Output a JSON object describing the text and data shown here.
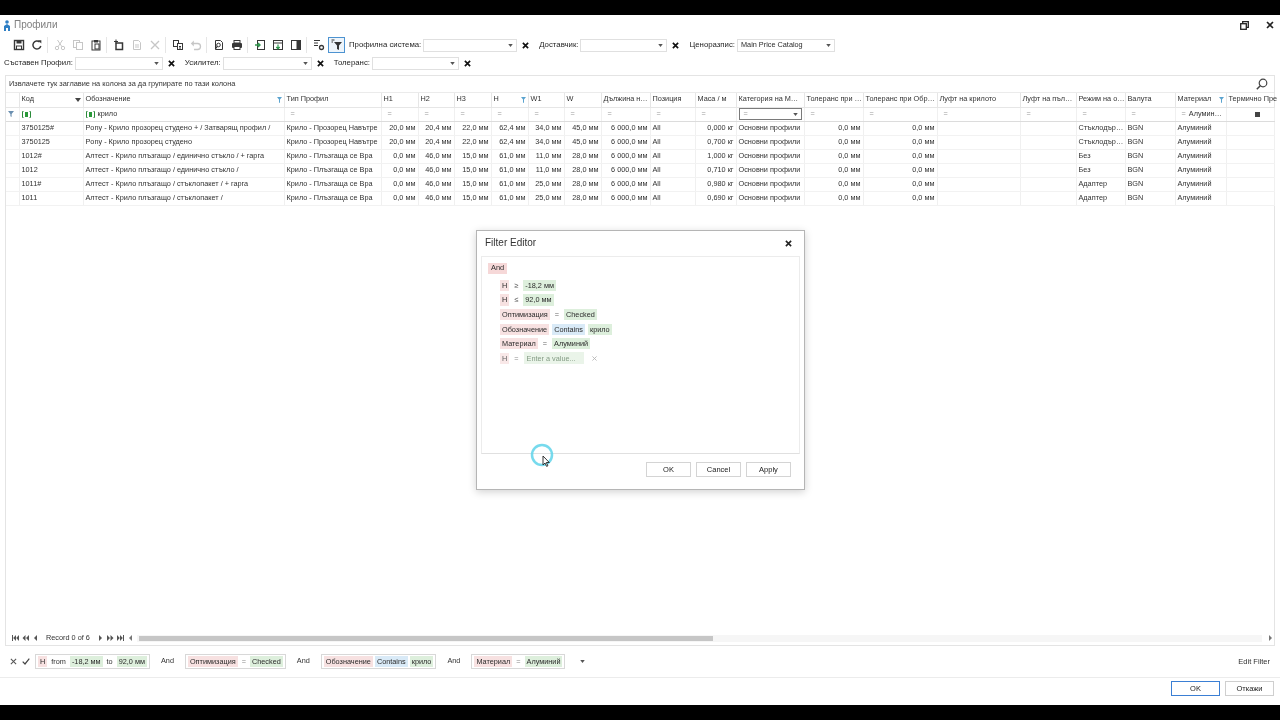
{
  "window": {
    "title": "Профили"
  },
  "toolbar": {
    "groups": [
      [
        {
          "disabled": false,
          "on": false
        },
        {
          "disabled": false,
          "on": false
        }
      ],
      [
        {
          "disabled": true,
          "on": false
        },
        {
          "disabled": true,
          "on": false
        },
        {
          "disabled": false,
          "on": false
        }
      ],
      [
        {
          "disabled": false,
          "on": false
        },
        {
          "disabled": true,
          "on": false
        },
        {
          "disabled": true,
          "on": false
        }
      ],
      [
        {
          "disabled": false,
          "on": false
        },
        {
          "disabled": true,
          "on": false
        }
      ],
      [
        {
          "disabled": false,
          "on": false
        },
        {
          "disabled": false,
          "on": false
        }
      ],
      [
        {
          "disabled": false,
          "on": false
        },
        {
          "disabled": false,
          "on": false
        },
        {
          "disabled": false,
          "on": false
        }
      ],
      [
        {
          "disabled": false,
          "on": false
        },
        {
          "disabled": false,
          "on": true
        }
      ]
    ],
    "selectors": [
      {
        "label": "Профилна система:",
        "clearable": true
      },
      {
        "label": "Доставчик:",
        "clearable": true
      },
      {
        "label": "Ценоразпис:",
        "value": "Main Price Catalog",
        "clearable": false
      }
    ]
  },
  "selector_row": [
    {
      "label": "Съставен Профил:",
      "clearable": true
    },
    {
      "label": "Усилител:",
      "clearable": true
    },
    {
      "label": "Толеранс:",
      "clearable": true
    }
  ],
  "grid": {
    "group_panel": "Извлачете тук заглавие на колона за да групирате по тази колона",
    "columns": [
      {
        "title": "Код",
        "kind": "text",
        "sorted": true,
        "filtered": false
      },
      {
        "title": "Обозначение",
        "kind": "text",
        "sorted": false,
        "filtered": true
      },
      {
        "title": "Тип Профил",
        "kind": "text",
        "sorted": false,
        "filtered": false
      },
      {
        "title": "H1",
        "kind": "number",
        "sorted": false,
        "filtered": false
      },
      {
        "title": "H2",
        "kind": "number",
        "sorted": false,
        "filtered": false
      },
      {
        "title": "H3",
        "kind": "number",
        "sorted": false,
        "filtered": false
      },
      {
        "title": "H",
        "kind": "number",
        "sorted": false,
        "filtered": true
      },
      {
        "title": "W1",
        "kind": "number",
        "sorted": false,
        "filtered": false
      },
      {
        "title": "W",
        "kind": "number",
        "sorted": false,
        "filtered": false
      },
      {
        "title": "Дължина н…",
        "kind": "number",
        "sorted": false,
        "filtered": false
      },
      {
        "title": "Позиция",
        "kind": "text",
        "sorted": false,
        "filtered": false
      },
      {
        "title": "Маса / м",
        "kind": "number",
        "sorted": false,
        "filtered": false
      },
      {
        "title": "Категория на М…",
        "kind": "text",
        "sorted": false,
        "filtered": false
      },
      {
        "title": "Толеранс при …",
        "kind": "number",
        "sorted": false,
        "filtered": false
      },
      {
        "title": "Толеранс при Обр…",
        "kind": "number",
        "sorted": false,
        "filtered": false
      },
      {
        "title": "Луфт на крилото",
        "kind": "number",
        "sorted": false,
        "filtered": false
      },
      {
        "title": "Луфт на пъл…",
        "kind": "number",
        "sorted": false,
        "filtered": false
      },
      {
        "title": "Режим на о…",
        "kind": "text",
        "sorted": false,
        "filtered": false
      },
      {
        "title": "Валута",
        "kind": "text",
        "sorted": false,
        "filtered": false
      },
      {
        "title": "Материал",
        "kind": "text",
        "sorted": false,
        "filtered": true
      },
      {
        "title": "Термично Пре",
        "kind": "text",
        "sorted": false,
        "filtered": false
      }
    ],
    "filter_row": [
      {
        "kind": "contains"
      },
      {
        "kind": "contains",
        "value": "крило"
      },
      {
        "kind": "equals",
        "operator": "="
      },
      {
        "kind": "equals",
        "operator": "="
      },
      {
        "kind": "equals",
        "operator": "="
      },
      {
        "kind": "equals",
        "operator": "="
      },
      {
        "kind": "equals",
        "operator": "="
      },
      {
        "kind": "equals",
        "operator": "="
      },
      {
        "kind": "equals",
        "operator": "="
      },
      {
        "kind": "equals",
        "operator": "="
      },
      {
        "kind": "equals",
        "operator": "="
      },
      {
        "kind": "equals",
        "operator": "="
      },
      {
        "kind": "combo",
        "operator": "="
      },
      {
        "kind": "equals",
        "operator": "="
      },
      {
        "kind": "equals",
        "operator": "="
      },
      {
        "kind": "equals",
        "operator": "="
      },
      {
        "kind": "equals",
        "operator": "="
      },
      {
        "kind": "equals",
        "operator": "="
      },
      {
        "kind": "equals",
        "operator": "="
      },
      {
        "kind": "equals",
        "operator": "=",
        "value": "Алумин…"
      },
      {
        "kind": "check",
        "indeterminate": true
      }
    ],
    "rows": [
      [
        "3750125#",
        "Pony - Крило прозорец студено + / Затварящ профил /",
        "Крило - Прозорец Навътре",
        "20,0 мм",
        "20,4 мм",
        "22,0 мм",
        "62,4 мм",
        "34,0 мм",
        "45,0 мм",
        "6 000,0 мм",
        "All",
        "0,000 кг",
        "Основни профили",
        "0,0 мм",
        "0,0 мм",
        null,
        null,
        "Стъклодър…",
        "BGN",
        "Алуминий",
        null
      ],
      [
        "3750125",
        "Pony - Крило прозорец студено",
        "Крило - Прозорец Навътре",
        "20,0 мм",
        "20,4 мм",
        "22,0 мм",
        "62,4 мм",
        "34,0 мм",
        "45,0 мм",
        "6 000,0 мм",
        "All",
        "0,700 кг",
        "Основни профили",
        "0,0 мм",
        "0,0 мм",
        null,
        null,
        "Стъклодър…",
        "BGN",
        "Алуминий",
        null
      ],
      [
        "1012#",
        "Алтест - Крило плъзгащо / единично стъкло / + гарга",
        "Крило - Плъзгаща се Вра",
        "0,0 мм",
        "46,0 мм",
        "15,0 мм",
        "61,0 мм",
        "11,0 мм",
        "28,0 мм",
        "6 000,0 мм",
        "All",
        "1,000 кг",
        "Основни профили",
        "0,0 мм",
        "0,0 мм",
        null,
        null,
        "Без",
        "BGN",
        "Алуминий",
        null
      ],
      [
        "1012",
        "Алтест - Крило плъзгащо / единично стъкло /",
        "Крило - Плъзгаща се Вра",
        "0,0 мм",
        "46,0 мм",
        "15,0 мм",
        "61,0 мм",
        "11,0 мм",
        "28,0 мм",
        "6 000,0 мм",
        "All",
        "0,710 кг",
        "Основни профили",
        "0,0 мм",
        "0,0 мм",
        null,
        null,
        "Без",
        "BGN",
        "Алуминий",
        null
      ],
      [
        "1011#",
        "Алтест - Крило плъзгащо / стъклопакет / + гарга",
        "Крило - Плъзгаща се Вра",
        "0,0 мм",
        "46,0 мм",
        "15,0 мм",
        "61,0 мм",
        "25,0 мм",
        "28,0 мм",
        "6 000,0 мм",
        "All",
        "0,980 кг",
        "Основни профили",
        "0,0 мм",
        "0,0 мм",
        null,
        null,
        "Адаптер",
        "BGN",
        "Алуминий",
        null
      ],
      [
        "1011",
        "Алтест - Крило плъзгащо / стъклопакет /",
        "Крило - Плъзгаща се Вра",
        "0,0 мм",
        "46,0 мм",
        "15,0 мм",
        "61,0 мм",
        "25,0 мм",
        "28,0 мм",
        "6 000,0 мм",
        "All",
        "0,690 кг",
        "Основни профили",
        "0,0 мм",
        "0,0 мм",
        null,
        null,
        "Адаптер",
        "BGN",
        "Алуминий",
        null
      ]
    ],
    "navigator": "Record 0 of 6"
  },
  "filter_bar": {
    "enabled": true,
    "items": [
      {
        "kind": "group",
        "parts": [
          {
            "kind": "field",
            "text": "H"
          },
          {
            "kind": "keyword",
            "text": "from"
          },
          {
            "kind": "value",
            "text": "-18,2 мм"
          },
          {
            "kind": "keyword",
            "text": "to"
          },
          {
            "kind": "value",
            "text": "92,0 мм"
          }
        ]
      },
      {
        "kind": "joiner",
        "text": "And"
      },
      {
        "kind": "group",
        "parts": [
          {
            "kind": "field",
            "text": "Оптимизация"
          },
          {
            "kind": "symbol",
            "text": "="
          },
          {
            "kind": "value",
            "text": "Checked"
          }
        ]
      },
      {
        "kind": "joiner",
        "text": "And"
      },
      {
        "kind": "group",
        "parts": [
          {
            "kind": "field",
            "text": "Обозначение"
          },
          {
            "kind": "word",
            "text": "Contains"
          },
          {
            "kind": "value",
            "text": "крило"
          }
        ]
      },
      {
        "kind": "joiner",
        "text": "And"
      },
      {
        "kind": "group",
        "parts": [
          {
            "kind": "field",
            "text": "Материал"
          },
          {
            "kind": "symbol",
            "text": "="
          },
          {
            "kind": "value",
            "text": "Алуминий"
          }
        ]
      }
    ],
    "edit_link": "Edit Filter"
  },
  "buttons": [
    {
      "label": "OK",
      "default": true
    },
    {
      "label": "Откажи",
      "default": false
    }
  ],
  "filter_editor": {
    "title": "Filter Editor",
    "tree": {
      "text": "And",
      "children": [
        {
          "draft": false,
          "parts": [
            {
              "kind": "field",
              "text": "H"
            },
            {
              "kind": "symbol",
              "text": "≥"
            },
            {
              "kind": "value",
              "text": "-18,2 мм"
            }
          ]
        },
        {
          "draft": false,
          "parts": [
            {
              "kind": "field",
              "text": "H"
            },
            {
              "kind": "symbol",
              "text": "≤"
            },
            {
              "kind": "value",
              "text": "92,0 мм"
            }
          ]
        },
        {
          "draft": false,
          "parts": [
            {
              "kind": "field",
              "text": "Оптимизация"
            },
            {
              "kind": "symbol",
              "text": "="
            },
            {
              "kind": "value",
              "text": "Checked"
            }
          ]
        },
        {
          "draft": false,
          "parts": [
            {
              "kind": "field",
              "text": "Обозначение"
            },
            {
              "kind": "word",
              "text": "Contains"
            },
            {
              "kind": "value",
              "text": "крило"
            }
          ]
        },
        {
          "draft": false,
          "parts": [
            {
              "kind": "field",
              "text": "Материал"
            },
            {
              "kind": "symbol",
              "text": "="
            },
            {
              "kind": "value",
              "text": "Алуминий"
            }
          ]
        },
        {
          "draft": true,
          "parts": [
            {
              "kind": "field",
              "text": "H"
            },
            {
              "kind": "symbol",
              "text": "="
            },
            {
              "kind": "input",
              "placeholder": "Enter a value..."
            }
          ]
        }
      ]
    },
    "buttons": [
      "OK",
      "Cancel",
      "Apply"
    ]
  }
}
